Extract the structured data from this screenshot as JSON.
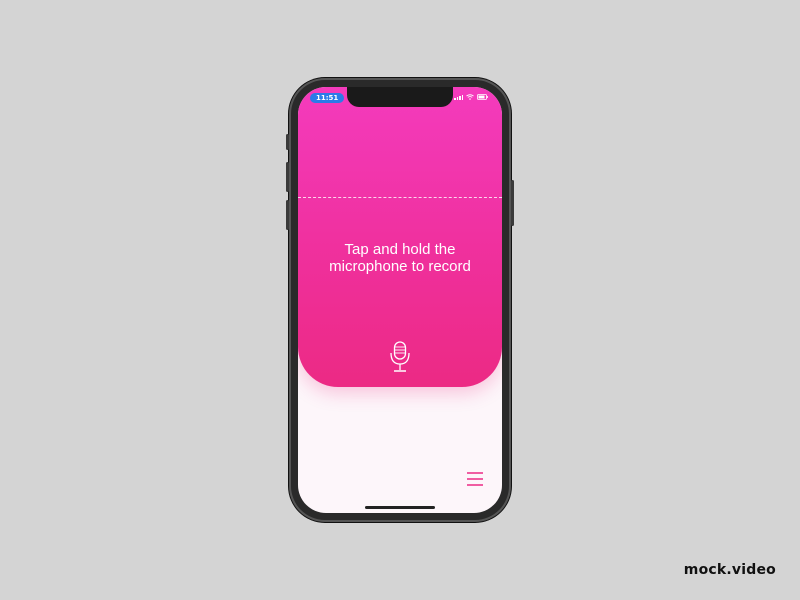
{
  "status_bar": {
    "time": "11:51",
    "icons": [
      "signal-icon",
      "wifi-icon",
      "battery-icon"
    ]
  },
  "main": {
    "prompt": "Tap and hold the microphone to record",
    "mic_icon": "microphone-icon",
    "menu_icon": "hamburger-menu-icon"
  },
  "watermark": {
    "text": "mock.video"
  },
  "colors": {
    "background": "#d4d4d4",
    "panel_top": "#f43bbd",
    "panel_bottom": "#ec2a84",
    "accent": "#ec2a84",
    "status_pill": "#2b7be8"
  }
}
